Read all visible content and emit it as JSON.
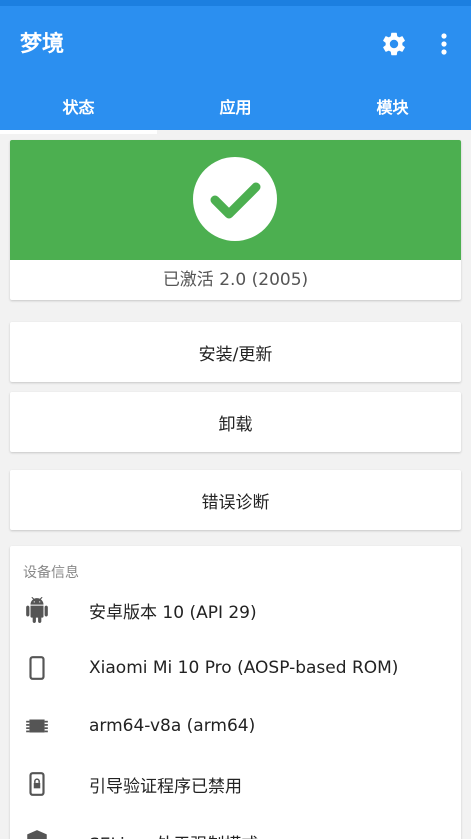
{
  "app": {
    "title": "梦境",
    "accent_color": "#2b8ff0",
    "icons": [
      "gear-icon",
      "more-vert-icon"
    ]
  },
  "tabs": [
    {
      "label": "状态",
      "selected": true
    },
    {
      "label": "应用",
      "selected": false
    },
    {
      "label": "模块",
      "selected": false
    }
  ],
  "status": {
    "text": "已激活 2.0 (2005)",
    "color": "#4caf50",
    "icon": "check-circle-icon"
  },
  "actions": {
    "install_label": "安装/更新",
    "uninstall_label": "卸载",
    "diagnose_label": "错误诊断"
  },
  "device_info": {
    "header": "设备信息",
    "items": [
      {
        "icon": "android-icon",
        "text": "安卓版本 10 (API 29)"
      },
      {
        "icon": "phone-icon",
        "text": "Xiaomi Mi 10 Pro (AOSP-based ROM)"
      },
      {
        "icon": "chip-icon",
        "text": "arm64-v8a (arm64)"
      },
      {
        "icon": "lock-phone-icon",
        "text": "引导验证程序已禁用"
      },
      {
        "icon": "shield-icon",
        "text": "SELinux处于强制模式"
      }
    ]
  }
}
